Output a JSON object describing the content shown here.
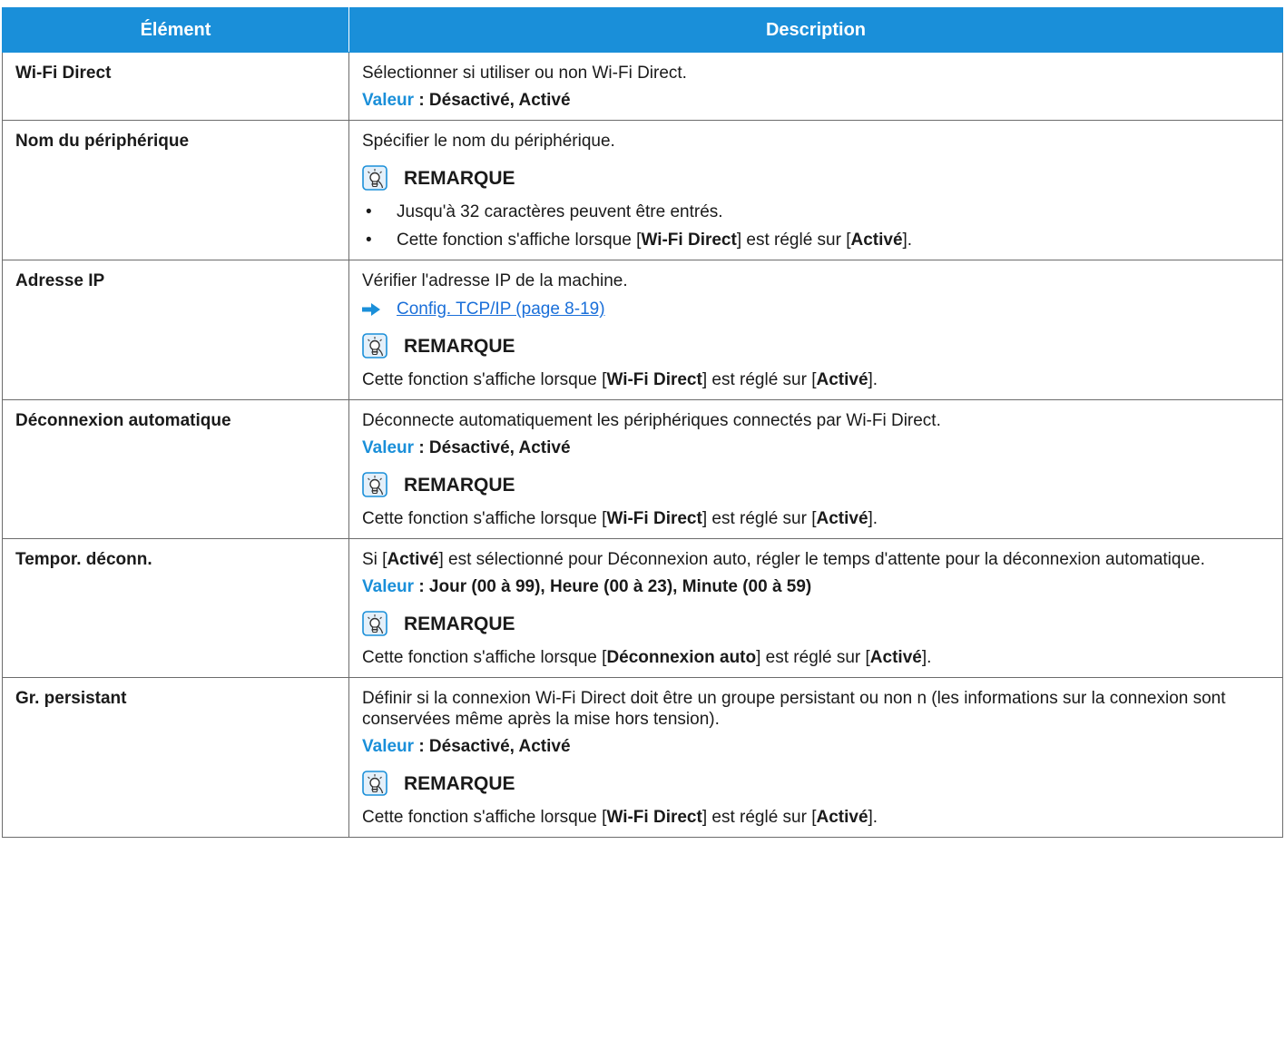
{
  "headers": {
    "item": "Élément",
    "description": "Description"
  },
  "rows": [
    {
      "item": "Wi-Fi Direct",
      "desc": "Sélectionner si utiliser ou non Wi-Fi Direct.",
      "value_label": "Valeur",
      "value_text": " : Désactivé, Activé"
    },
    {
      "item": "Nom du périphérique",
      "desc": "Spécifier le nom du périphérique.",
      "note_title": "REMARQUE",
      "bullet1": "Jusqu'à 32 caractères peuvent être entrés.",
      "bullet2_a": "Cette fonction s'affiche lorsque [",
      "bullet2_b": "Wi-Fi Direct",
      "bullet2_c": "] est réglé sur [",
      "bullet2_d": "Activé",
      "bullet2_e": "]."
    },
    {
      "item": "Adresse IP",
      "desc": "Vérifier l'adresse IP de la machine.",
      "link": "Config. TCP/IP (page 8-19)",
      "note_title": "REMARQUE",
      "note_a": "Cette fonction s'affiche lorsque [",
      "note_b": "Wi-Fi Direct",
      "note_c": "] est réglé sur [",
      "note_d": "Activé",
      "note_e": "]."
    },
    {
      "item": "Déconnexion automatique",
      "desc": "Déconnecte automatiquement les périphériques connectés par Wi-Fi Direct.",
      "value_label": "Valeur",
      "value_text": " : Désactivé, Activé",
      "note_title": "REMARQUE",
      "note_a": "Cette fonction s'affiche lorsque [",
      "note_b": "Wi-Fi Direct",
      "note_c": "] est réglé sur [",
      "note_d": "Activé",
      "note_e": "]."
    },
    {
      "item": "Tempor. déconn.",
      "desc_a": "Si [",
      "desc_b": "Activé",
      "desc_c": "] est sélectionné pour Déconnexion auto, régler le temps d'attente pour la déconnexion automatique.",
      "value_label": "Valeur",
      "value_text": " : Jour (00 à 99), Heure (00 à 23), Minute (00 à 59)",
      "note_title": "REMARQUE",
      "note_a": "Cette fonction s'affiche lorsque [",
      "note_b": "Déconnexion auto",
      "note_c": "] est réglé sur [",
      "note_d": "Activé",
      "note_e": "]."
    },
    {
      "item": "Gr. persistant",
      "desc": "Définir si la connexion Wi-Fi Direct doit être un groupe persistant ou non n (les informations sur la connexion sont conservées même après la mise hors tension).",
      "value_label": "Valeur",
      "value_text": " : Désactivé, Activé",
      "note_title": "REMARQUE",
      "note_a": "Cette fonction s'affiche lorsque [",
      "note_b": "Wi-Fi Direct",
      "note_c": "] est réglé sur [",
      "note_d": "Activé",
      "note_e": "]."
    }
  ],
  "colors": {
    "header_bg": "#1a8fd9",
    "value_label": "#1a8fd9",
    "link": "#1a6fd9"
  },
  "icons": {
    "note": "note-lightbulb-icon",
    "link": "arrow-right-icon"
  }
}
